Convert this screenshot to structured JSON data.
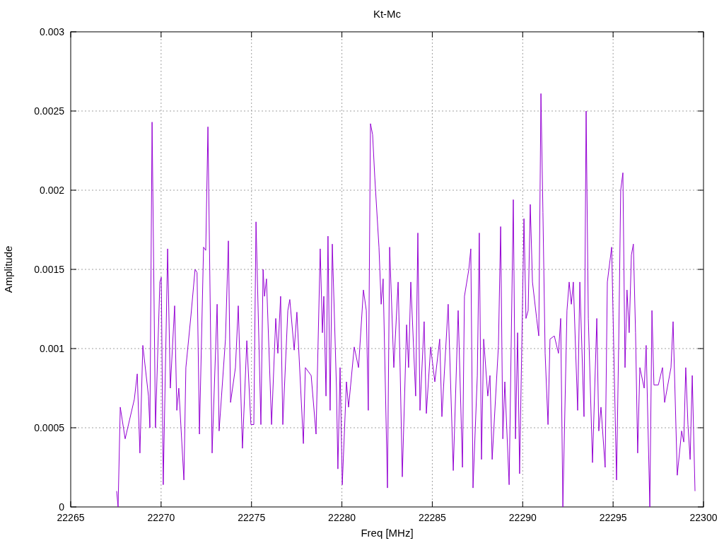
{
  "chart": {
    "chart_data": {
      "type": "line",
      "grid": true,
      "title": "Kt-Mc",
      "xlabel": "Freq [MHz]",
      "ylabel": "Amplitude",
      "xlim": [
        22265,
        22300
      ],
      "ylim": [
        0,
        0.003
      ],
      "xticks": [
        22265,
        22270,
        22275,
        22280,
        22285,
        22290,
        22295,
        22300
      ],
      "yticks": [
        0,
        0.0005,
        0.001,
        0.0015,
        0.002,
        0.0025,
        0.003
      ],
      "x": [
        22267.54,
        22267.62,
        22267.74,
        22268.01,
        22268.52,
        22268.68,
        22268.83,
        22268.99,
        22269.3,
        22269.38,
        22269.5,
        22269.69,
        22269.93,
        22270.01,
        22270.12,
        22270.36,
        22270.51,
        22270.75,
        22270.87,
        22270.98,
        22271.26,
        22271.37,
        22271.65,
        22271.88,
        22271.99,
        22272.12,
        22272.35,
        22272.47,
        22272.59,
        22272.82,
        22273.1,
        22273.21,
        22273.56,
        22273.72,
        22273.84,
        22274.11,
        22274.27,
        22274.5,
        22274.74,
        22274.97,
        22275.13,
        22275.25,
        22275.52,
        22275.64,
        22275.72,
        22275.83,
        22276.11,
        22276.34,
        22276.46,
        22276.61,
        22276.73,
        22277.01,
        22277.12,
        22277.36,
        22277.51,
        22277.87,
        22277.98,
        22278.3,
        22278.57,
        22278.8,
        22278.92,
        22279.0,
        22279.12,
        22279.23,
        22279.35,
        22279.47,
        22279.7,
        22279.78,
        22279.9,
        22280.02,
        22280.25,
        22280.37,
        22280.68,
        22280.92,
        22281.19,
        22281.35,
        22281.46,
        22281.58,
        22281.7,
        22281.82,
        22282.05,
        22282.17,
        22282.28,
        22282.52,
        22282.64,
        22282.87,
        22283.11,
        22283.22,
        22283.34,
        22283.58,
        22283.69,
        22283.81,
        22284.08,
        22284.2,
        22284.32,
        22284.55,
        22284.67,
        22284.91,
        22285.14,
        22285.41,
        22285.53,
        22285.88,
        22286.16,
        22286.43,
        22286.67,
        22286.78,
        22287.02,
        22287.13,
        22287.25,
        22287.49,
        22287.6,
        22287.72,
        22287.84,
        22288.07,
        22288.19,
        22288.31,
        22288.66,
        22288.78,
        22288.9,
        22289.01,
        22289.25,
        22289.48,
        22289.6,
        22289.72,
        22289.83,
        22290.07,
        22290.18,
        22290.3,
        22290.42,
        22290.54,
        22290.77,
        22290.89,
        22291.01,
        22291.12,
        22291.24,
        22291.4,
        22291.51,
        22291.75,
        22291.98,
        22292.1,
        22292.22,
        22292.45,
        22292.57,
        22292.69,
        22292.8,
        22293.04,
        22293.16,
        22293.39,
        22293.51,
        22293.63,
        22293.86,
        22294.1,
        22294.21,
        22294.33,
        22294.56,
        22294.68,
        22294.92,
        22295.19,
        22295.31,
        22295.42,
        22295.54,
        22295.66,
        22295.77,
        22295.89,
        22296.01,
        22296.12,
        22296.24,
        22296.36,
        22296.48,
        22296.72,
        22296.83,
        22297.03,
        22297.15,
        22297.26,
        22297.5,
        22297.73,
        22297.85,
        22298.2,
        22298.32,
        22298.55,
        22298.79,
        22298.91,
        22299.02,
        22299.14,
        22299.26,
        22299.38,
        22299.53
      ],
      "series": [
        {
          "color": "#9400d3",
          "values": [
            0.0001,
            0,
            0.00063,
            0.00043,
            0.00068,
            0.00084,
            0.00034,
            0.00102,
            0.0007,
            0.0005,
            0.00243,
            0.0005,
            0.00142,
            0.00145,
            0.00014,
            0.00163,
            0.00075,
            0.00127,
            0.00061,
            0.00075,
            0.00017,
            0.00088,
            0.00121,
            0.0015,
            0.00148,
            0.00046,
            0.00164,
            0.00162,
            0.0024,
            0.00034,
            0.00128,
            0.00048,
            0.00106,
            0.00168,
            0.00066,
            0.00088,
            0.00127,
            0.00037,
            0.00105,
            0.00052,
            0.00052,
            0.0018,
            0.00052,
            0.0015,
            0.00133,
            0.00144,
            0.00052,
            0.00119,
            0.00097,
            0.00133,
            0.00052,
            0.00124,
            0.00131,
            0.00099,
            0.00123,
            0.0004,
            0.00088,
            0.00083,
            0.00046,
            0.00163,
            0.0011,
            0.00133,
            0.0007,
            0.00171,
            0.00061,
            0.00166,
            0.00075,
            0.00024,
            0.00088,
            0.00014,
            0.00079,
            0.00063,
            0.00101,
            0.00088,
            0.00137,
            0.00124,
            0.00061,
            0.00242,
            0.00235,
            0.00208,
            0.00164,
            0.00128,
            0.00144,
            0.00012,
            0.00164,
            0.00088,
            0.00142,
            0.00088,
            0.00019,
            0.00115,
            0.00088,
            0.00142,
            0.0007,
            0.00173,
            0.00061,
            0.00117,
            0.00059,
            0.00101,
            0.00079,
            0.00106,
            0.00057,
            0.00128,
            0.00023,
            0.00124,
            0.00025,
            0.00133,
            0.0015,
            0.00163,
            0.00012,
            0.00083,
            0.00173,
            0.0003,
            0.00106,
            0.0007,
            0.00083,
            0.0003,
            0.00102,
            0.00177,
            0.00043,
            0.00079,
            0.00014,
            0.00194,
            0.00043,
            0.0011,
            0.00021,
            0.00182,
            0.00119,
            0.00124,
            0.00191,
            0.00142,
            0.00119,
            0.00108,
            0.00261,
            0.00186,
            0.00097,
            0.00052,
            0.00106,
            0.00108,
            0.00097,
            0.00119,
            0,
            0.00124,
            0.00142,
            0.00128,
            0.00142,
            0.00061,
            0.00142,
            0.00057,
            0.0025,
            0.00119,
            0.00028,
            0.00119,
            0.00048,
            0.00063,
            0.00025,
            0.00142,
            0.00164,
            0.00017,
            0.00104,
            0.002,
            0.00211,
            0.00088,
            0.00137,
            0.0011,
            0.00159,
            0.00166,
            0.0011,
            0.00034,
            0.00088,
            0.00075,
            0.00102,
            0,
            0.00124,
            0.00077,
            0.00077,
            0.00088,
            0.00066,
            0.00088,
            0.00117,
            0.0002,
            0.00048,
            0.00041,
            0.00088,
            0.00052,
            0.0003,
            0.00083,
            0.0001
          ]
        }
      ]
    }
  }
}
